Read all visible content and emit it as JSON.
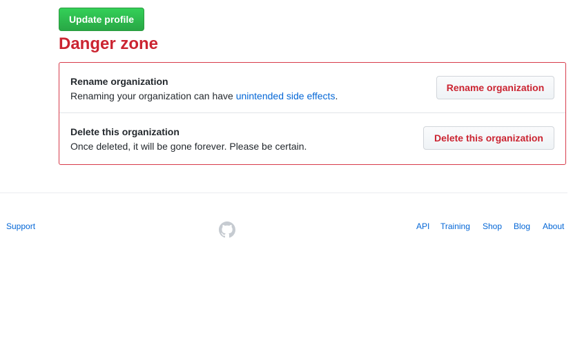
{
  "profile": {
    "update_button": "Update profile"
  },
  "danger_zone": {
    "heading": "Danger zone",
    "rename": {
      "title": "Rename organization",
      "description_prefix": "Renaming your organization can have ",
      "description_link": "unintended side effects",
      "description_suffix": ".",
      "button": "Rename organization"
    },
    "delete": {
      "title": "Delete this organization",
      "description": "Once deleted, it will be gone forever. Please be certain.",
      "button": "Delete this organization"
    }
  },
  "footer": {
    "left_links": [
      "Support"
    ],
    "logo_icon": "github-mark-icon",
    "right_links": [
      "API",
      "Training",
      "Shop",
      "Blog",
      "About"
    ]
  },
  "colors": {
    "primary_green": "#28a745",
    "danger_red": "#cb2431",
    "danger_border": "#d73a49",
    "link_blue": "#0366d6"
  }
}
